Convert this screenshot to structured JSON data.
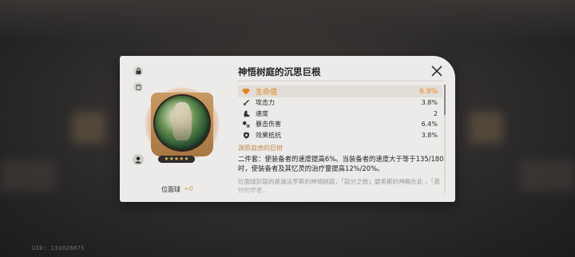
{
  "uid": "UID: 133028875",
  "relic": {
    "title": "神悟树庭的沉思巨根",
    "stars": "★★★★★",
    "level_label": "位面球",
    "level_value": "+0"
  },
  "main_stat": {
    "name": "生命值",
    "value": "6.9%",
    "icon": "heart-icon",
    "color": "#e08520"
  },
  "sub_stats": [
    {
      "name": "攻击力",
      "value": "3.8%",
      "icon": "sword-icon"
    },
    {
      "name": "速度",
      "value": "2",
      "icon": "boot-icon"
    },
    {
      "name": "暴击伤害",
      "value": "6.4%",
      "icon": "crit-damage-icon"
    },
    {
      "name": "效果抵抗",
      "value": "3.8%",
      "icon": "shield-icon"
    }
  ],
  "set": {
    "name": "渊思寂虑的巨树",
    "description": "二件套：使装备者的速度提高6%。当装备者的速度大于等于135/180时，使装备者及其忆灵的治疗量提高12%/20%。",
    "lore": "位面球封装的是翁法罗斯的神悟树庭，「裂分之枝」瑟希斯的神殿在此 ，「悬铃的学者，"
  }
}
